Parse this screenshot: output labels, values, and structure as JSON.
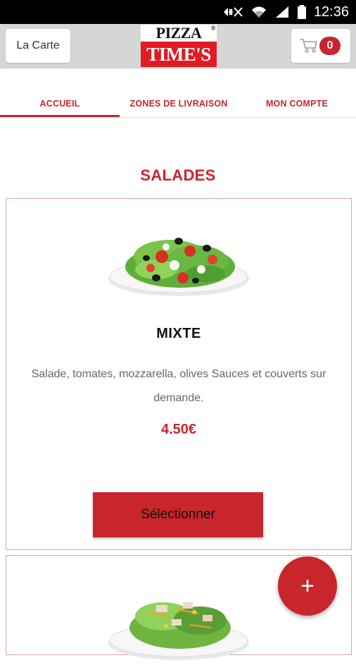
{
  "status_bar": {
    "time": "12:36"
  },
  "header": {
    "menu_button_label": "La Carte",
    "logo": {
      "line1": "PIZZA",
      "line2": "TIME'S",
      "trademark": "®"
    },
    "cart_count": "0"
  },
  "tabs": [
    {
      "label": "ACCUEIL",
      "active": true
    },
    {
      "label": "ZONES DE LIVRAISON",
      "active": false
    },
    {
      "label": "MON COMPTE",
      "active": false
    }
  ],
  "section": {
    "title": "SALADES"
  },
  "items": [
    {
      "name": "MIXTE",
      "description": "Salade, tomates, mozzarella, olives  Sauces et couverts sur demande.",
      "price": "4.50€",
      "button_label": "Sélectionner"
    }
  ],
  "fab": {
    "label": "+"
  },
  "colors": {
    "accent": "#c8252c",
    "logo_red": "#e01b22",
    "header_bg": "#d6d6d6"
  }
}
